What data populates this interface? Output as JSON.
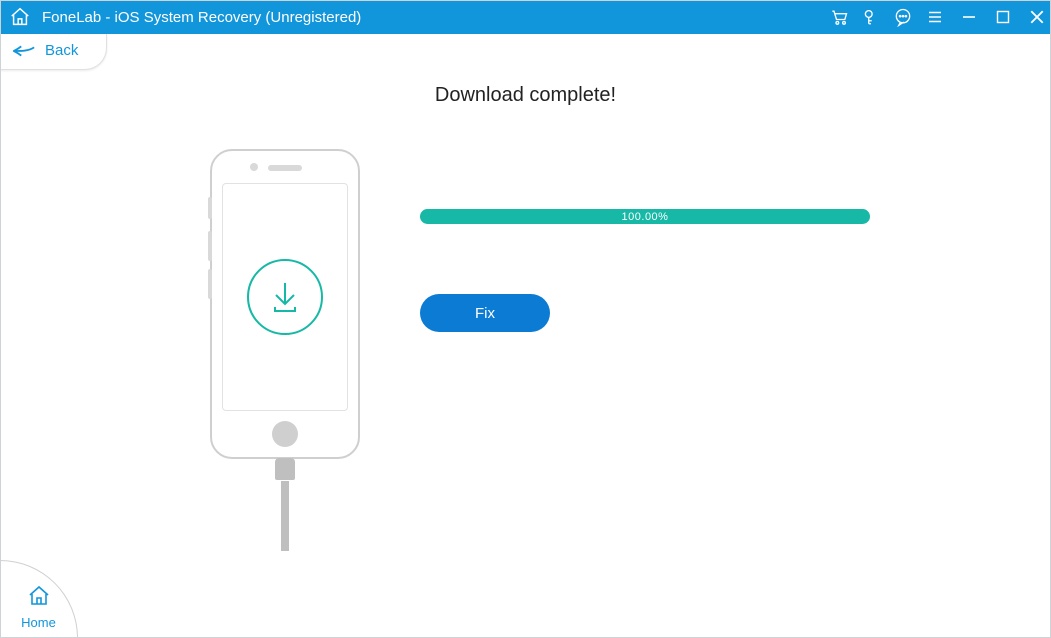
{
  "titlebar": {
    "title": "FoneLab - iOS System Recovery (Unregistered)"
  },
  "nav": {
    "back_label": "Back",
    "home_label": "Home"
  },
  "main": {
    "headline": "Download complete!",
    "progress_text": "100.00%",
    "fix_label": "Fix"
  },
  "colors": {
    "brand_blue": "#1296db",
    "accent_teal": "#17b8a6",
    "button_blue": "#0b7bd4"
  }
}
